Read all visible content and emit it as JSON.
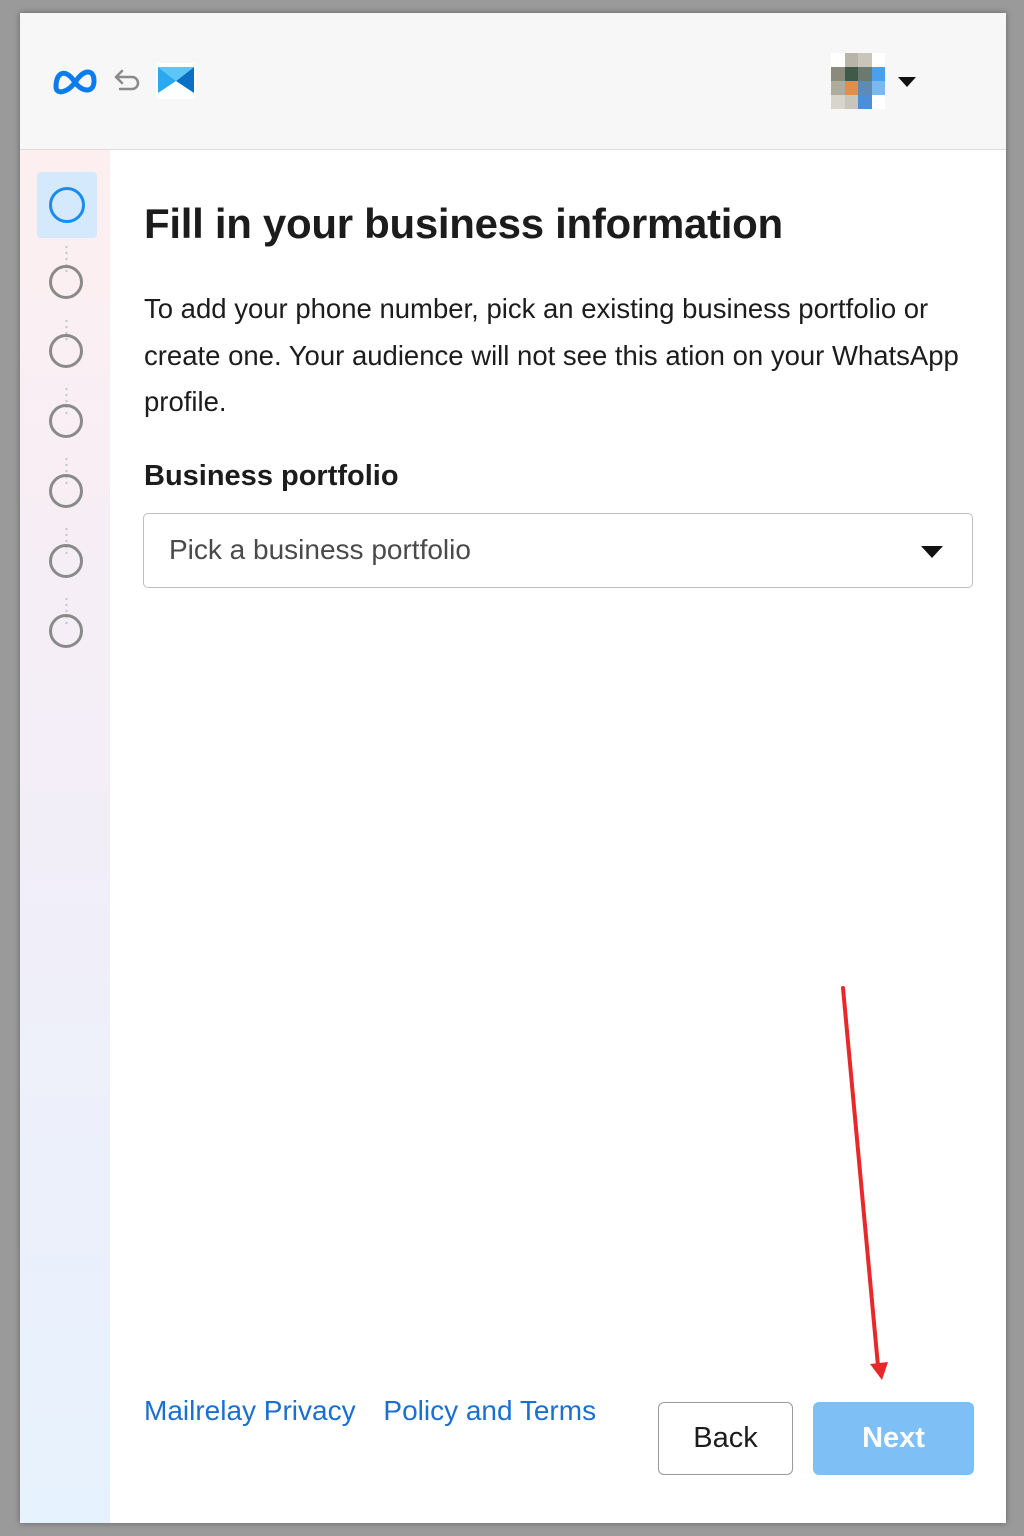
{
  "header": {
    "meta_logo_icon": "meta-infinity-logo",
    "swap_icon": "swap-arrow-icon",
    "app_logo_icon": "mailrelay-logo",
    "account_caret_icon": "caret-down-icon"
  },
  "sidebar": {
    "steps": [
      {
        "state": "active"
      },
      {
        "state": "pending"
      },
      {
        "state": "pending"
      },
      {
        "state": "pending"
      },
      {
        "state": "pending"
      },
      {
        "state": "pending"
      },
      {
        "state": "pending"
      }
    ]
  },
  "main": {
    "title": "Fill in your business information",
    "description": "To add your phone number, pick an existing business portfolio or create one. Your audience will not see this ation on your WhatsApp profile.",
    "field_label": "Business portfolio",
    "select_placeholder": "Pick a business portfolio"
  },
  "footer": {
    "link_privacy": "Mailrelay Privacy",
    "link_terms": "Policy and Terms",
    "back_label": "Back",
    "next_label": "Next"
  },
  "colors": {
    "accent": "#1a8cf0",
    "next_button": "#7ebff6",
    "link": "#1a6fd0",
    "annotation_arrow": "#e8282b"
  }
}
